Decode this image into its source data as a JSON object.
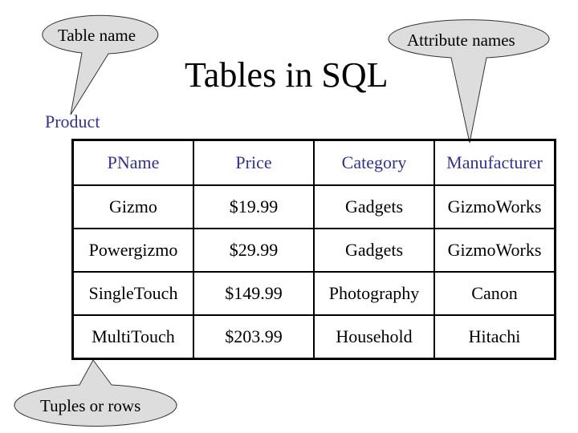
{
  "title": "Tables in SQL",
  "table_name": "Product",
  "callouts": {
    "table_name": "Table name",
    "attribute_names": "Attribute names",
    "tuples": "Tuples or rows"
  },
  "colors": {
    "header_text": "#333388",
    "callout_fill": "#dddddd"
  },
  "table": {
    "columns": [
      "PName",
      "Price",
      "Category",
      "Manufacturer"
    ],
    "rows": [
      [
        "Gizmo",
        "$19.99",
        "Gadgets",
        "GizmoWorks"
      ],
      [
        "Powergizmo",
        "$29.99",
        "Gadgets",
        "GizmoWorks"
      ],
      [
        "SingleTouch",
        "$149.99",
        "Photography",
        "Canon"
      ],
      [
        "MultiTouch",
        "$203.99",
        "Household",
        "Hitachi"
      ]
    ]
  }
}
